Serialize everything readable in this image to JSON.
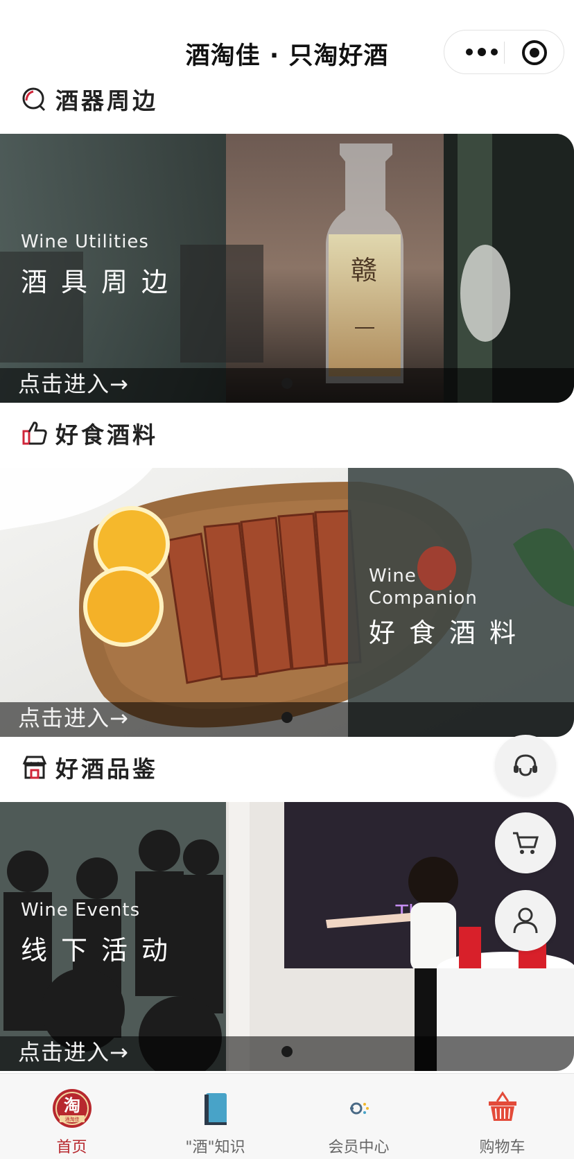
{
  "nav": {
    "title": "酒淘佳 · 只淘好酒"
  },
  "sections": [
    {
      "title": "酒器周边",
      "icon": "search-icon",
      "banner": {
        "en": "Wine Utilities",
        "cn": "酒具周边",
        "enter": "点击进入→"
      }
    },
    {
      "title": "好食酒料",
      "icon": "thumbs-up-icon",
      "banner": {
        "en": "Wine Companion",
        "cn": "好食酒料",
        "enter": "点击进入→"
      }
    },
    {
      "title": "好酒品鉴",
      "icon": "shop-icon",
      "banner": {
        "en": "Wine Events",
        "cn": "线下活动",
        "enter": "点击进入→"
      }
    }
  ],
  "floating": [
    "customer-service-icon",
    "cart-icon",
    "user-icon"
  ],
  "tabbar": {
    "items": [
      {
        "label": "首页",
        "icon": "home-logo-icon",
        "active": true,
        "logo_text": "淘",
        "logo_sub": "酒淘佳"
      },
      {
        "label": "\"酒\"知识",
        "icon": "book-icon",
        "active": false
      },
      {
        "label": "会员中心",
        "icon": "member-icon",
        "active": false
      },
      {
        "label": "购物车",
        "icon": "basket-icon",
        "active": false
      }
    ]
  },
  "colors": {
    "accent": "#b7282e",
    "tab_inactive": "#666666"
  }
}
